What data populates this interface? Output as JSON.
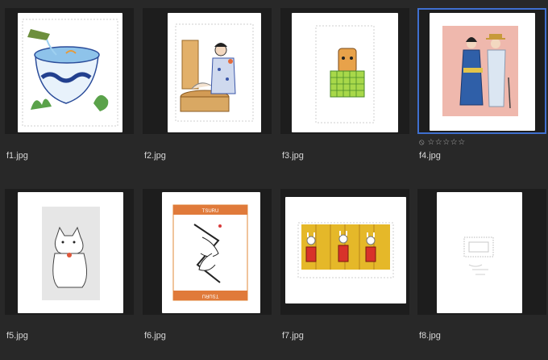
{
  "files": [
    {
      "name": "f1.jpg",
      "selected": false
    },
    {
      "name": "f2.jpg",
      "selected": false
    },
    {
      "name": "f3.jpg",
      "selected": false
    },
    {
      "name": "f4.jpg",
      "selected": true
    },
    {
      "name": "f5.jpg",
      "selected": false
    },
    {
      "name": "f6.jpg",
      "selected": false
    },
    {
      "name": "f7.jpg",
      "selected": false
    },
    {
      "name": "f8.jpg",
      "selected": false
    }
  ],
  "rating": {
    "reject_icon": "⦸",
    "stars": [
      "☆",
      "☆",
      "☆",
      "☆",
      "☆"
    ]
  },
  "crane_card": {
    "top_text": "TSURU",
    "bottom_text": "TSURU"
  },
  "colors": {
    "background": "#282828",
    "thumb_bg": "#1d1d1d",
    "selection": "#3f6fcf",
    "label": "#d6d6d6"
  }
}
